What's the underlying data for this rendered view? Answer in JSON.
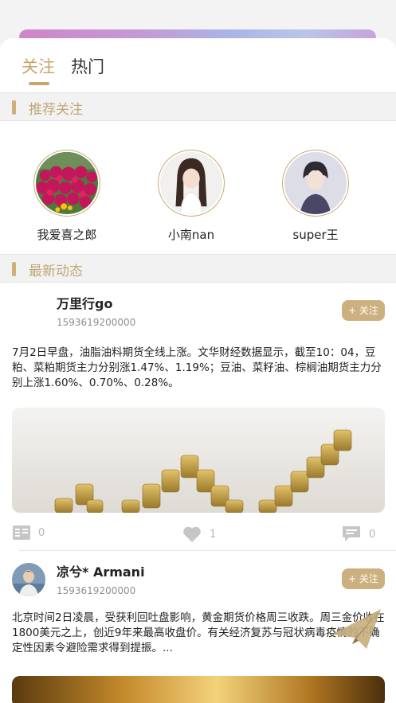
{
  "tabs": {
    "following": "关注",
    "hot": "热门"
  },
  "sections": {
    "recommend": "推荐关注",
    "latest": "最新动态"
  },
  "recommend_users": [
    {
      "name": "我爱喜之郎"
    },
    {
      "name": "小南nan"
    },
    {
      "name": "super王"
    }
  ],
  "posts": [
    {
      "author": "万里行go",
      "time": "1593619200000",
      "follow_label": "+ 关注",
      "text": "7月2日早盘，油脂油料期货全线上涨。文华财经数据显示，截至10：04，豆粕、菜粕期货主力分别涨1.47%、1.19%；豆油、菜籽油、棕榈油期货主力分别上涨1.60%、0.70%、0.28%。",
      "comments": "0",
      "likes": "1",
      "messages": "0"
    },
    {
      "author": "凉兮* Armani",
      "time": "1593619200000",
      "follow_label": "+ 关注",
      "text": "北京时间2日凌晨，受获利回吐盘影响，黄金期货价格周三收跌。周三金价收在1800美元之上，创近9年来最高收盘价。有关经济复苏与冠状病毒疫情的不确定性因素令避险需求得到提振。..."
    }
  ],
  "colors": {
    "accent": "#c8a66a",
    "follow_bg": "#cdb07f"
  }
}
